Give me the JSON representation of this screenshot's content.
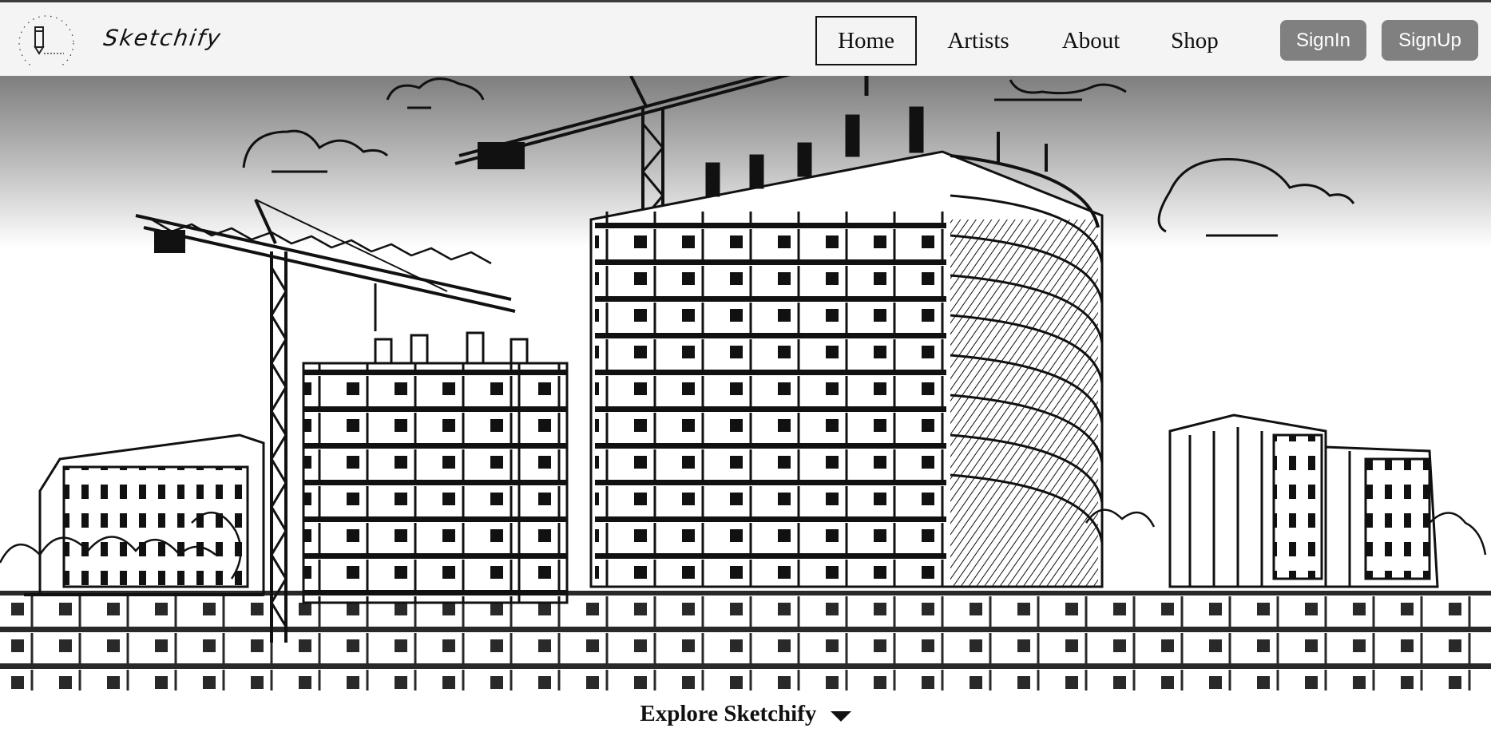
{
  "brand": {
    "name": "Sketchify"
  },
  "nav": {
    "items": [
      {
        "label": "Home",
        "active": true
      },
      {
        "label": "Artists",
        "active": false
      },
      {
        "label": "About",
        "active": false
      },
      {
        "label": "Shop",
        "active": false
      }
    ]
  },
  "auth": {
    "signin_label": "SignIn",
    "signup_label": "SignUp"
  },
  "explore": {
    "label": "Explore Sketchify",
    "icon": "caret-down-icon"
  },
  "colors": {
    "navbar_bg": "#f4f4f4",
    "button_bg": "#808080",
    "button_text": "#ffffff",
    "text": "#111111"
  }
}
